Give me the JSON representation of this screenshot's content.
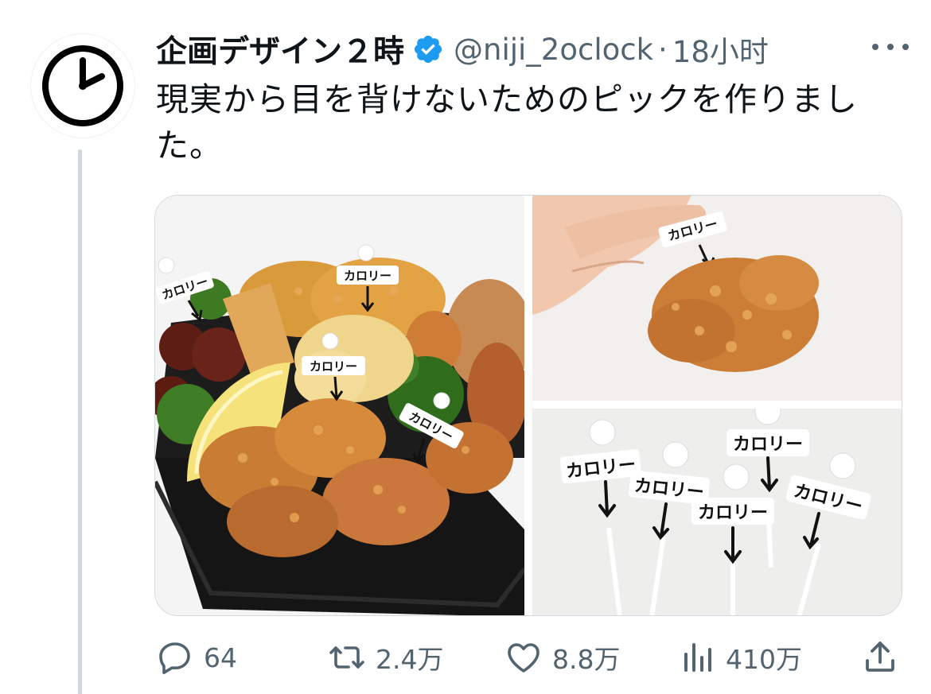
{
  "tweet": {
    "display_name": "企画デザイン２時",
    "handle": "@niji_2oclock",
    "separator": "·",
    "time": "18小时",
    "text": "現実から目を背けないためのピックを作りました。",
    "avatar_icon": "clock-icon",
    "verified_icon": "verified-badge-icon",
    "accent_color": "#1d9bf0"
  },
  "media": {
    "photos": [
      {
        "icon": "fried-food-bento-photo",
        "picks": [
          "カロリー",
          "カロリー",
          "カロリー",
          "カロリー"
        ]
      },
      {
        "icon": "karaage-pick-photo",
        "picks": [
          "カロリー"
        ]
      },
      {
        "icon": "calorie-picks-photo",
        "picks": [
          "カロリー",
          "カロリー",
          "カロリー",
          "カロリー",
          "カロリー"
        ]
      }
    ]
  },
  "actions": {
    "reply_count": "64",
    "retweet_count": "2.4万",
    "like_count": "8.8万",
    "view_count": "410万"
  }
}
